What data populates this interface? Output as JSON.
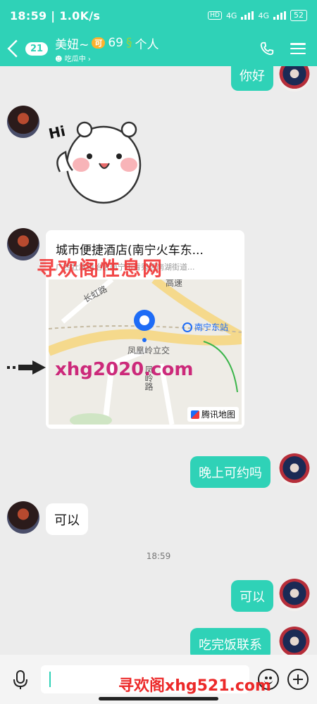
{
  "status": {
    "time": "18:59",
    "speed": "1.0K/s",
    "net1": "4G",
    "net2": "4G",
    "battery": "52",
    "hd": "HD"
  },
  "header": {
    "unread_count": "21",
    "name": "美妞~",
    "vip_badge": "可",
    "level": "69",
    "name_suffix": "个人",
    "status": "吃瓜中"
  },
  "messages": [
    {
      "from": "me",
      "text": "你好"
    },
    {
      "from": "other",
      "type": "sticker",
      "text": "Hi"
    },
    {
      "from": "other",
      "type": "location",
      "title": "城市便捷酒店(南宁火车东...",
      "address": "广西壮族自治区南宁市青秀区南湖街道..."
    },
    {
      "from": "me",
      "text": "晚上可约吗"
    },
    {
      "from": "other",
      "text": "可以"
    },
    {
      "from": "me",
      "text": "可以"
    },
    {
      "from": "me",
      "text": "吃完饭联系"
    }
  ],
  "time_divider": "18:59",
  "map": {
    "road1": "长虹路",
    "road2": "凤凰岭立交",
    "road3": "凤岭路",
    "road4": "高速",
    "station": "南宁东站",
    "provider": "腾讯地图"
  },
  "watermarks": {
    "w1": "寻欢阁性息网",
    "w2": "xhg2020.com",
    "w3": "寻欢阁xhg521.com"
  },
  "colors": {
    "accent": "#2fd2b7"
  }
}
